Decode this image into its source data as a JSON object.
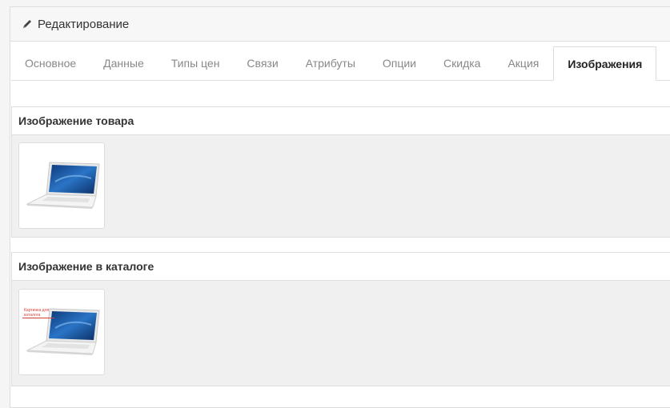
{
  "header": {
    "title": "Редактирование",
    "icon": "pencil-icon"
  },
  "tabs": [
    {
      "label": "Основное",
      "active": false
    },
    {
      "label": "Данные",
      "active": false
    },
    {
      "label": "Типы цен",
      "active": false
    },
    {
      "label": "Связи",
      "active": false
    },
    {
      "label": "Атрибуты",
      "active": false
    },
    {
      "label": "Опции",
      "active": false
    },
    {
      "label": "Скидка",
      "active": false
    },
    {
      "label": "Акция",
      "active": false
    },
    {
      "label": "Изображения",
      "active": true
    }
  ],
  "sections": {
    "product_image": {
      "title": "Изображение товара",
      "image": "laptop-image"
    },
    "catalog_image": {
      "title": "Изображение в каталоге",
      "image": "laptop-image",
      "note": "Картинка для каталога"
    }
  },
  "colors": {
    "accent": "#d43f3a",
    "border": "#dddddd"
  }
}
